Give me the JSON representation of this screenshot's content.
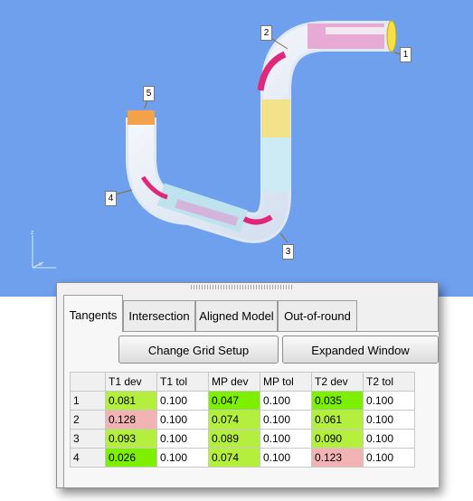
{
  "viewport": {
    "background": "#6fa0ee",
    "callouts": [
      "1",
      "2",
      "3",
      "4",
      "5"
    ],
    "axes": {
      "z_label": "z",
      "x_label": "x"
    }
  },
  "tabs": [
    "Tangents",
    "Intersection",
    "Aligned Model",
    "Out-of-round"
  ],
  "active_tab": "Tangents",
  "buttons": {
    "change_grid": "Change Grid Setup",
    "expanded": "Expanded Window"
  },
  "table": {
    "columns": [
      "T1 dev",
      "T1 tol",
      "MP dev",
      "MP tol",
      "T2 dev",
      "T2 tol"
    ],
    "rows": [
      {
        "id": "1",
        "cells": [
          "0.081",
          "0.100",
          "0.047",
          "0.100",
          "0.035",
          "0.100"
        ]
      },
      {
        "id": "2",
        "cells": [
          "0.128",
          "0.100",
          "0.074",
          "0.100",
          "0.061",
          "0.100"
        ]
      },
      {
        "id": "3",
        "cells": [
          "0.093",
          "0.100",
          "0.089",
          "0.100",
          "0.090",
          "0.100"
        ]
      },
      {
        "id": "4",
        "cells": [
          "0.026",
          "0.100",
          "0.074",
          "0.100",
          "0.123",
          "0.100"
        ]
      }
    ],
    "status_colors": {
      "bright_green": "#7cf000",
      "lime": "#b5ef3e",
      "pink": "#f1b3b3"
    },
    "cell_status": [
      [
        "lime",
        "",
        "bright_green",
        "",
        "bright_green",
        ""
      ],
      [
        "pink",
        "",
        "lime",
        "",
        "lime",
        ""
      ],
      [
        "lime",
        "",
        "lime",
        "",
        "lime",
        ""
      ],
      [
        "bright_green",
        "",
        "lime",
        "",
        "pink",
        ""
      ]
    ]
  }
}
